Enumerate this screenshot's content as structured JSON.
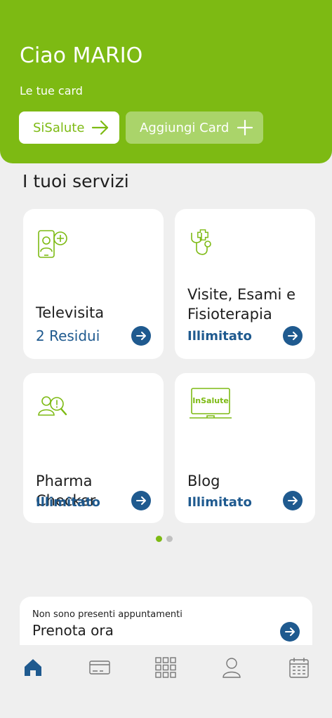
{
  "header": {
    "greeting": "Ciao MARIO",
    "cards_label": "Le tue card",
    "primary_card": {
      "label": "SiSalute",
      "icon": "arrow-right-icon"
    },
    "add_card": {
      "label": "Aggiungi Card",
      "icon": "plus-icon"
    }
  },
  "services": {
    "title": "I tuoi servizi",
    "tiles": [
      {
        "name": "Televisita",
        "status": "2 Residui",
        "icon": "doctor-phone-icon"
      },
      {
        "name": "Visite, Esami e Fisioterapia",
        "status": "Illimitato",
        "icon": "stethoscope-icon"
      },
      {
        "name": "Pharma Checker",
        "status": "Illimitato",
        "icon": "person-search-icon"
      },
      {
        "name": "Blog",
        "status": "Illimitato",
        "icon": "laptop-icon",
        "icon_text": "InSalute"
      }
    ],
    "pager": {
      "pages": 2,
      "active": 1
    }
  },
  "appointments": {
    "note": "Non sono presenti appuntamenti",
    "cta": "Prenota ora"
  },
  "tabbar": {
    "items": [
      "home-icon",
      "card-icon",
      "grid-icon",
      "profile-icon",
      "calendar-icon"
    ],
    "active": "home-icon"
  },
  "colors": {
    "brand_green": "#7dba13",
    "accent_blue": "#1f5a8f",
    "background": "#efefef"
  }
}
